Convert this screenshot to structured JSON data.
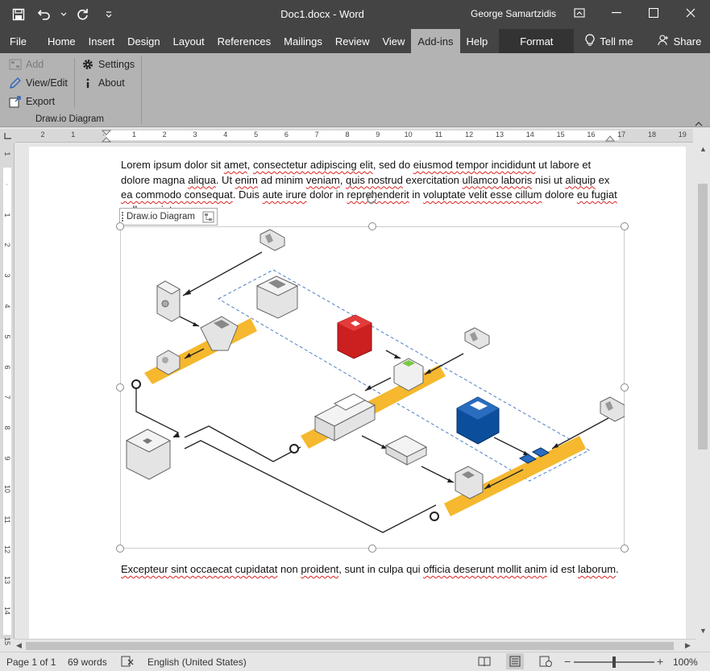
{
  "window": {
    "document_title": "Doc1.docx  -  Word",
    "user_name": "George Samartzidis"
  },
  "qat": {
    "save_icon": "save-icon",
    "undo_icon": "undo-icon",
    "redo_icon": "redo-icon",
    "customize_icon": "customize-qat-icon"
  },
  "tabs": [
    {
      "label": "File"
    },
    {
      "label": "Home"
    },
    {
      "label": "Insert"
    },
    {
      "label": "Design"
    },
    {
      "label": "Layout"
    },
    {
      "label": "References"
    },
    {
      "label": "Mailings"
    },
    {
      "label": "Review"
    },
    {
      "label": "View"
    },
    {
      "label": "Add-ins"
    },
    {
      "label": "Help"
    },
    {
      "label": "Format"
    }
  ],
  "tell_me": "Tell me",
  "share": "Share",
  "ribbon": {
    "add": "Add",
    "view_edit": "View/Edit",
    "export": "Export",
    "settings": "Settings",
    "about": "About",
    "group_label": "Draw.io Diagram"
  },
  "ruler": {
    "h_numbers": [
      "2",
      "1",
      "",
      "1",
      "2",
      "3",
      "4",
      "5",
      "6",
      "7",
      "8",
      "9",
      "10",
      "11",
      "12",
      "13",
      "14",
      "15",
      "16",
      "17",
      "18",
      "19"
    ],
    "v_numbers": [
      "1",
      "",
      "1",
      "2",
      "3",
      "4",
      "5",
      "6",
      "7",
      "8",
      "9",
      "10",
      "11",
      "12",
      "13",
      "14",
      "15"
    ]
  },
  "document": {
    "para1_a": "Lorem ipsum dolor sit ",
    "para1_b": "amet",
    "para1_c": ", ",
    "para1_d": "consectetur adipiscing elit",
    "para1_e": ", sed do ",
    "para1_f": "eiusmod tempor incididunt",
    "para1_g": " ut labore et dolore magna ",
    "para1_h": "aliqua",
    "para1_i": ". Ut ",
    "para1_j": "enim",
    "para1_k": " ad minim ",
    "para1_l": "veniam",
    "para1_m": ", ",
    "para1_n": "quis nostrud",
    "para1_o": " exercitation ",
    "para1_p": "ullamco laboris",
    "para1_q": " nisi ut ",
    "para1_r": "aliquip",
    "para1_s": " ex ",
    "para1_t": "ea commodo consequat",
    "para1_u": ". Duis ",
    "para1_v": "aute irure",
    "para1_w": " dolor in ",
    "para1_x": "reprehenderit",
    "para1_y": " in ",
    "para1_z": "voluptate velit esse cillum",
    "para1_aa": " dolore ",
    "para1_bb": "eu fugiat nulla pariatur",
    "para1_cc": ".",
    "diagram_label": "Draw.io Diagram",
    "para2_a": "Excepteur sint occaecat cupidatat",
    "para2_b": " non ",
    "para2_c": "proident",
    "para2_d": ", sunt in culpa qui ",
    "para2_e": "officia deserunt mollit anim",
    "para2_f": " id est ",
    "para2_g": "laborum",
    "para2_h": "."
  },
  "status": {
    "page": "Page 1 of 1",
    "words": "69 words",
    "language": "English (United States)",
    "zoom": "100%",
    "zoom_percent": 100
  },
  "colors": {
    "title_bar": "#444444",
    "ribbon": "#b3b3b3",
    "accent_orange": "#f5b82e",
    "server_red": "#cc1f1f",
    "server_blue": "#0b4f9c",
    "green": "#7ac943"
  }
}
